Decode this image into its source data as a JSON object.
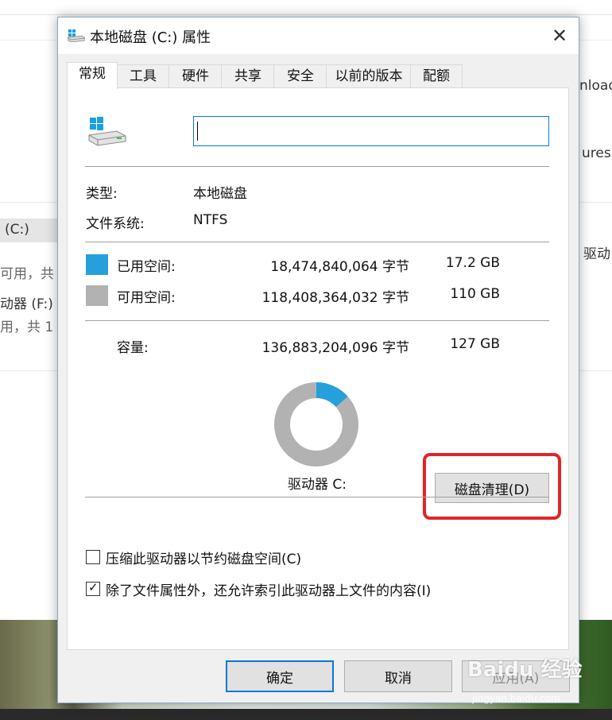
{
  "background_window": {
    "right_texts": [
      "nload",
      "ures",
      "驱动"
    ],
    "left_texts": [
      "(C:)",
      "可用，共",
      "动器 (F:) C",
      "用，共 1"
    ]
  },
  "dialog": {
    "title": "本地磁盘 (C:) 属性",
    "close_glyph": "✕",
    "tabs": [
      "常规",
      "工具",
      "硬件",
      "共享",
      "安全",
      "以前的版本",
      "配额"
    ],
    "active_tab": "常规",
    "volume_name_value": "",
    "type_label": "类型:",
    "type_value": "本地磁盘",
    "fs_label": "文件系统:",
    "fs_value": "NTFS",
    "used": {
      "label": "已用空间:",
      "bytes": "18,474,840,064 字节",
      "size": "17.2 GB",
      "color": "#26a0da"
    },
    "free": {
      "label": "可用空间:",
      "bytes": "118,408,364,032 字节",
      "size": "110 GB",
      "color": "#b2b2b2"
    },
    "capacity": {
      "label": "容量:",
      "bytes": "136,883,204,096 字节",
      "size": "127 GB"
    },
    "drive_label": "驱动器 C:",
    "cleanup_button": "磁盘清理(D)",
    "compress_checkbox": {
      "label": "压缩此驱动器以节约磁盘空间(C)",
      "checked": false
    },
    "index_checkbox": {
      "label": "除了文件属性外，还允许索引此驱动器上文件的内容(I)",
      "checked": true
    },
    "check_glyph": "✓",
    "ok_button": "确定",
    "cancel_button": "取消",
    "apply_button": "应用(A)"
  },
  "chart_data": {
    "type": "pie",
    "categories": [
      "已用空间",
      "可用空间"
    ],
    "values": [
      17.2,
      110
    ],
    "colors": [
      "#26a0da",
      "#b2b2b2"
    ],
    "title": ""
  },
  "watermark": {
    "text": "Baidu 经验",
    "sub": "jingyan.baidu.com"
  },
  "highlight_color": "#e0262a"
}
